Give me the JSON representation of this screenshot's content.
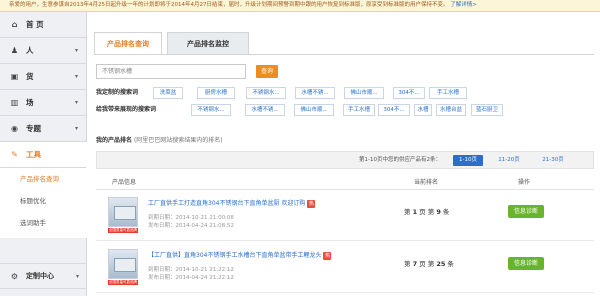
{
  "notice": {
    "text": "亲爱的用户，生意参谋自2013年4月25日起升级一年的计划即将于2014年4月27日结束，届时，升级计划期间预警到期中跟的用户恢复到标准版，原享受到标准版的用户保持不变。",
    "link": "了解详情>"
  },
  "sidebar": {
    "items": [
      {
        "icon": "home-icon",
        "glyph": "⌂",
        "label": "首 页",
        "arrow": ""
      },
      {
        "icon": "person-icon",
        "glyph": "♟",
        "label": "人",
        "arrow": "▾"
      },
      {
        "icon": "goods-icon",
        "glyph": "▣",
        "label": "货",
        "arrow": "▾"
      },
      {
        "icon": "field-icon",
        "glyph": "▥",
        "label": "场",
        "arrow": "▾"
      },
      {
        "icon": "topic-icon",
        "glyph": "◉",
        "label": "专题",
        "arrow": "▾"
      },
      {
        "icon": "tools-icon",
        "glyph": "✎",
        "label": "工具",
        "arrow": ""
      }
    ],
    "sub_items": [
      "产品排名查询",
      "标题优化",
      "选词助手"
    ],
    "bottom": {
      "icon": "gear-icon",
      "glyph": "⚙",
      "label": "定制中心",
      "arrow": "▾"
    }
  },
  "tabs": [
    {
      "label": "产品排名查询"
    },
    {
      "label": "产品排名监控"
    }
  ],
  "search": {
    "value": "不锈钢水槽",
    "button": "查询"
  },
  "my_keywords": {
    "label": "我定制的搜索词",
    "tags": [
      "洗菜盆",
      "厨房水槽",
      "不锈钢水...",
      "水槽不锈...",
      "佛山市顺...",
      "304不...",
      "手工水槽"
    ]
  },
  "recommend_keywords": {
    "label": "给我带来展现的搜索词",
    "tags": [
      "不锈钢水...",
      "水槽不锈...",
      "佛山市顺...",
      "手工水槽",
      "304不...",
      "水槽",
      "水槽台盆",
      "蓝石厨卫"
    ]
  },
  "results": {
    "title": "我的产品排名",
    "note": "(阿里巴巴网站搜索结果内的排名)",
    "pager_text": "第1-10页中您的供应产品有2条：",
    "pager": [
      "1-10页",
      "11-20页",
      "21-30页"
    ],
    "headers": {
      "info": "产品信息",
      "rank": "当前排名",
      "action": "操作"
    },
    "rows": [
      {
        "title": "工厂直供手工打造直角304不锈钢台下直角单盆厨 欢迎订购",
        "hot": "热",
        "badge": "全国质量可靠品牌",
        "date1": "到期日期：2014-10-21 21:00:08",
        "date2": "发布日期：2014-04-24 21:08:52",
        "rank_page": "1",
        "rank_pos": "9",
        "action": "信息诊断"
      },
      {
        "title": "【工厂直供】直角304不锈钢手工水槽台下直角单盆带手工鲤龙头",
        "hot": "热",
        "badge": "全国质量可靠品牌",
        "date1": "到期日期：2014-10-21 21:22:12",
        "date2": "发布日期：2014-04-24 21:22:12",
        "rank_page": "7",
        "rank_pos": "25",
        "action": "信息诊断"
      }
    ]
  }
}
